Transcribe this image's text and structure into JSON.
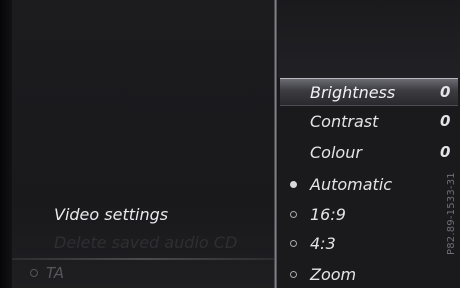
{
  "left_menu": {
    "video_settings": "Video settings",
    "delete_saved_audio": "Delete saved audio CD",
    "ta_label": "TA"
  },
  "right_menu": {
    "brightness": {
      "label": "Brightness",
      "value": "0"
    },
    "contrast": {
      "label": "Contrast",
      "value": "0"
    },
    "colour": {
      "label": "Colour",
      "value": "0"
    },
    "automatic": {
      "label": "Automatic"
    },
    "ratio_16_9": {
      "label": "16:9"
    },
    "ratio_4_3": {
      "label": "4:3"
    },
    "zoom": {
      "label": "Zoom"
    }
  },
  "image_ref": "P82.89-1533-31",
  "colors": {
    "highlight": "#6b6b72",
    "text": "#e3e3e8",
    "background": "#19191c"
  }
}
